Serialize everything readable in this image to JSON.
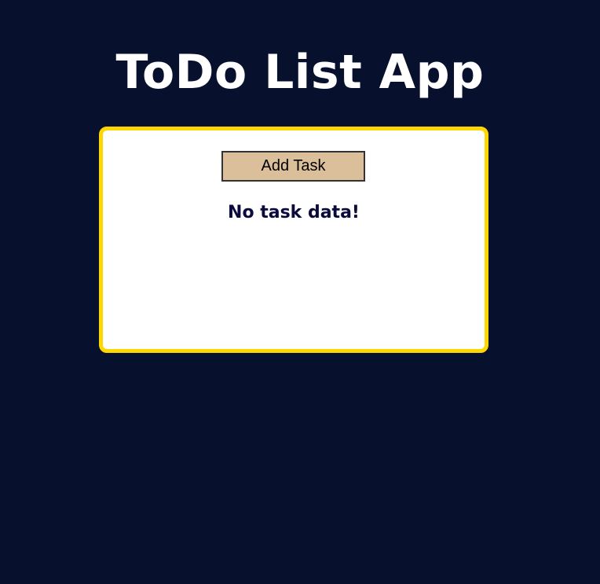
{
  "header": {
    "title": "ToDo List App"
  },
  "card": {
    "add_task_label": "Add Task",
    "empty_message": "No task data!"
  },
  "colors": {
    "background": "#07112e",
    "card_border": "#ffd700",
    "button_bg": "#dbbf9a",
    "message_text": "#0a0a3c"
  }
}
